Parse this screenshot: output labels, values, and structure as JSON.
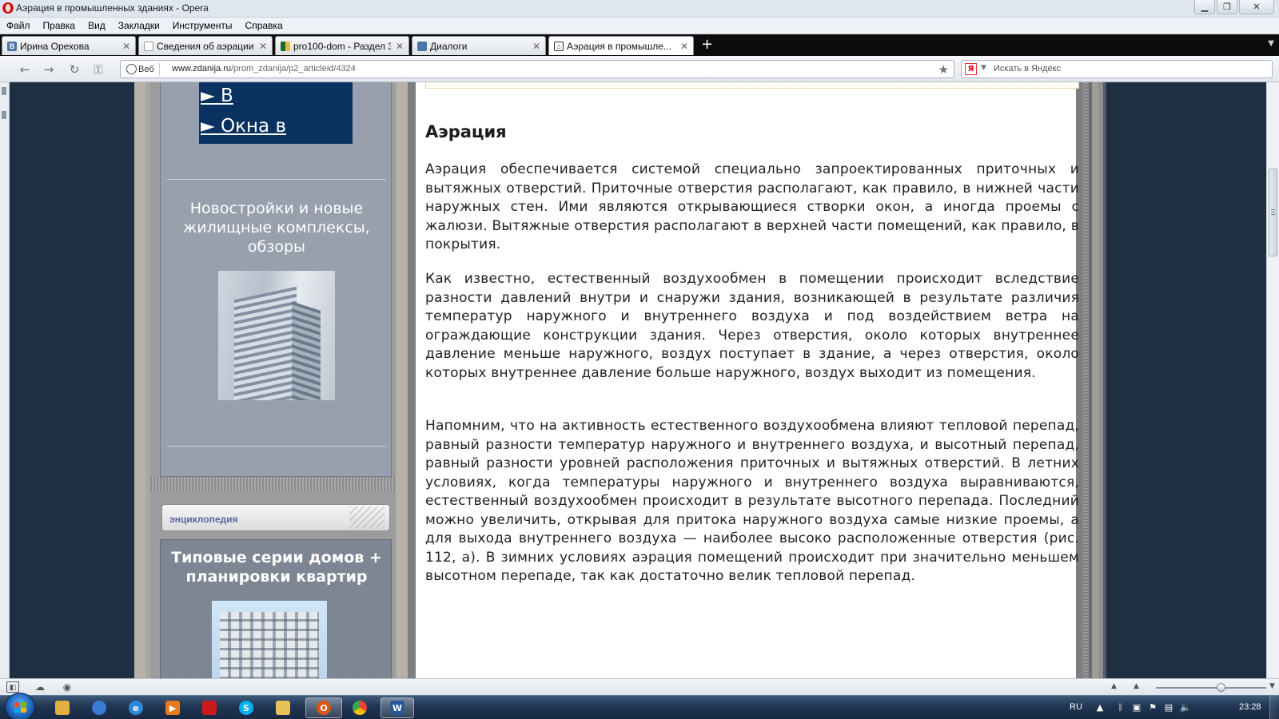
{
  "window": {
    "title": "Аэрация в промышленных зданиях - Opera"
  },
  "menu": [
    "Файл",
    "Правка",
    "Вид",
    "Закладки",
    "Инструменты",
    "Справка"
  ],
  "tabs": [
    {
      "label": "Ирина Орехова",
      "icon": "vk-icon",
      "color": "#4a76a8",
      "glyph": "В"
    },
    {
      "label": "Сведения об аэрации ...",
      "icon": "page-icon",
      "color": "#ffffff",
      "glyph": ""
    },
    {
      "label": "pro100-dom - Раздел 3...",
      "icon": "site-icon",
      "color": "#2a5a2a",
      "glyph": ""
    },
    {
      "label": "Диалоги",
      "icon": "chat-icon",
      "color": "#4a76a8",
      "glyph": ""
    },
    {
      "label": "Аэрация в промышле...",
      "icon": "site-house-icon",
      "color": "#333333",
      "glyph": ""
    }
  ],
  "address": {
    "badge": "Веб",
    "host": "www.zdanija.ru",
    "path": "/prom_zdanija/p2_articleid/4324",
    "search_placeholder": "Искать в Яндекс",
    "search_engine_glyph": "Я"
  },
  "sidebar": {
    "nav_links": [
      "► В",
      "► Окна в"
    ],
    "promo_text": "Новостройки и новые жилищные комплексы, обзоры",
    "encyclopedia_tab": "энциклопедия",
    "series_title": "Типовые серии домов + планировки квартир"
  },
  "article": {
    "heading": "Аэрация",
    "paragraphs": [
      "Аэрация обеспечивается системой специально запроектированных приточных и вытяжных отверстий. Приточные отверстия располагают, как правило, в нижней части наружных стен. Ими являются открывающиеся створки окон, а иногда проемы с жалюзи. Вытяжные отверстия располагают в верхней части помещений, как правило, в покрытия.",
      "Как известно, естественный воздухообмен в помещении происходит вследствие разности давлений внутри и снаружи здания, возникающей в результате различия температур наружного и внутреннего воздуха и под воздействием ветра на ограждающие конструкции здания. Через отверстия, около которых внутреннее давление меньше наружного, воздух поступает в здание, а через отверстия, около которых внутреннее давление больше наружного, воздух выходит из помещения.",
      "Напомним, что на активность естественного воздухообмена влияют тепловой перепад, равный разности температур наружного и внутреннего воздуха, и высотный перепад, равный разности уровней расположения приточных и вытяжных отверстий. В летних условиях, когда температуры наружного и внутреннего воздуха выравниваются, естественный воздухообмен происходит в результате высотного перепада. Последний можно увеличить, открывая для притока наружного воздуха самые низкие проемы, а для выхода внутреннего воздуха — наиболее высоко расположенные отверстия (рис. 112, а). В зимних условиях аэрация помещений происходит при значительно меньшем высотном перепаде, так как достаточно велик тепловой перепад."
    ]
  },
  "taskbar": {
    "language": "RU",
    "clock": "23:28",
    "apps": [
      {
        "name": "explorer-icon",
        "color": "#e0b040",
        "glyph": ""
      },
      {
        "name": "browser-icon",
        "color": "#3a7bd5",
        "glyph": ""
      },
      {
        "name": "ie-icon",
        "color": "#2a8ad8",
        "glyph": "e"
      },
      {
        "name": "media-player-icon",
        "color": "#e87a1d",
        "glyph": "▶"
      },
      {
        "name": "pdf-icon",
        "color": "#c81c1c",
        "glyph": ""
      },
      {
        "name": "skype-icon",
        "color": "#00aff0",
        "glyph": "S"
      },
      {
        "name": "folder-icon",
        "color": "#e8c05a",
        "glyph": ""
      },
      {
        "name": "opera-icon",
        "color": "#d51",
        "glyph": "O"
      },
      {
        "name": "chrome-icon",
        "color": "#34a853",
        "glyph": ""
      },
      {
        "name": "word-icon",
        "color": "#2b5797",
        "glyph": "W"
      }
    ]
  }
}
